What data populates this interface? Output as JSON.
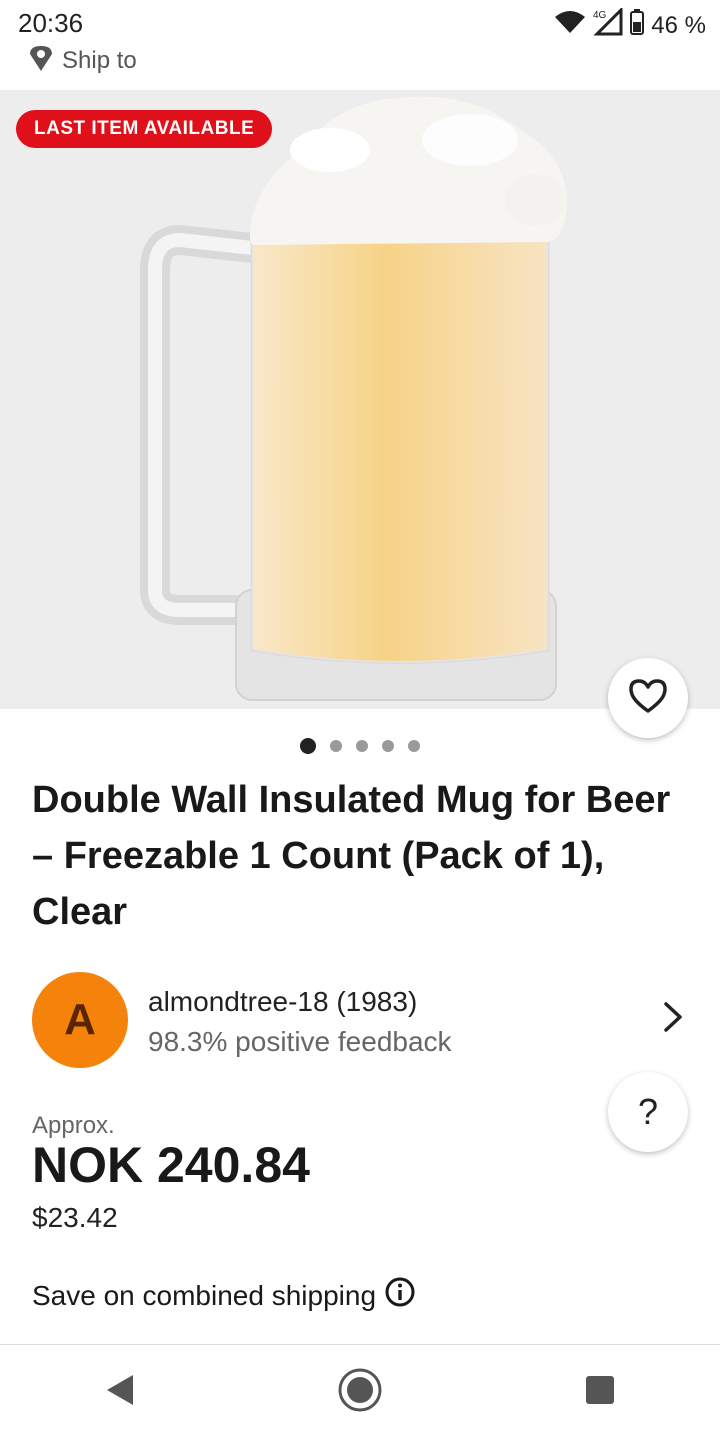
{
  "status_bar": {
    "time": "20:36",
    "network": "4G",
    "battery": "46 %"
  },
  "header": {
    "ship_to": "Ship to",
    "ship_icon": "location-pin-icon"
  },
  "product": {
    "badge": "LAST ITEM AVAILABLE",
    "image_alt": "Frosted beer mug with foam",
    "gallery_count": 5,
    "gallery_active": 0,
    "title": "Double Wall Insulated Mug for Beer – Freezable 1 Count (Pack of 1), Clear"
  },
  "seller": {
    "initial": "A",
    "name": "almondtree-18 (1983)",
    "feedback": "98.3% positive feedback",
    "avatar_color": "#f5820b"
  },
  "price": {
    "approx_label": "Approx.",
    "local": "NOK 240.84",
    "usd": "$23.42"
  },
  "shipping": {
    "combined": "Save on combined shipping"
  },
  "help_label": "?",
  "colors": {
    "badge_bg": "#e0101a",
    "text": "#191919"
  }
}
